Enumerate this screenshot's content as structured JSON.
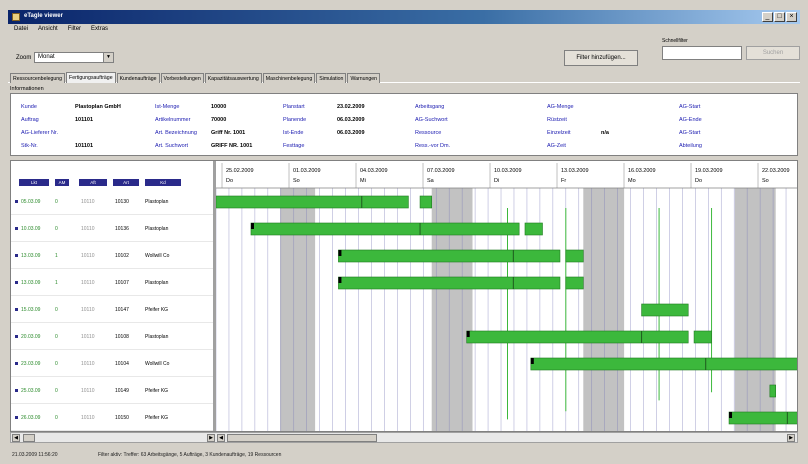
{
  "window": {
    "title": "eTagle viewer"
  },
  "menu": [
    "Datei",
    "Ansicht",
    "Filter",
    "Extras"
  ],
  "toolbar": {
    "zoom_label": "Zoom",
    "zoom_value": "Monat",
    "filter_button": "Filter hinzufügen...",
    "search_label": "Schnellfilter",
    "search_value": "",
    "search_button": "Suchen"
  },
  "tabs": [
    "Ressourcenbelegung",
    "Fertigungsaufträge",
    "Kundenaufträge",
    "Vorbestellungen",
    "Kapazitätsauswertung",
    "Maschinenbelegung",
    "Simulation",
    "Warnungen"
  ],
  "active_tab": 1,
  "info": {
    "label": "Informationen",
    "fields": [
      {
        "label": "Kunde",
        "value": "Plastoplan GmbH"
      },
      {
        "label": "Auftrag",
        "value": "101101"
      },
      {
        "label": "AG-Lieferer Nr.",
        "value": ""
      },
      {
        "label": "Stk-Nr.",
        "value": "101101"
      },
      {
        "label": "Ist-Menge",
        "value": "10000"
      },
      {
        "label": "Artikelnummer",
        "value": "70000"
      },
      {
        "label": "Art. Bezeichnung",
        "value": "Griff Nr. 1001"
      },
      {
        "label": "Art. Suchwort",
        "value": "GRIFF NR. 1001"
      },
      {
        "label": "Planstart",
        "value": "23.02.2009"
      },
      {
        "label": "Planende",
        "value": "06.03.2009"
      },
      {
        "label": "Ist-Ende",
        "value": "06.03.2009"
      },
      {
        "label": "Festtage",
        "value": ""
      },
      {
        "label": "Arbeitsgang",
        "value": ""
      },
      {
        "label": "AG-Suchwort",
        "value": ""
      },
      {
        "label": "Ressource",
        "value": ""
      },
      {
        "label": "Ress.-vor Dm.",
        "value": ""
      },
      {
        "label": "AG-Menge",
        "value": ""
      },
      {
        "label": "Rüstzeit",
        "value": ""
      },
      {
        "label": "Einzelzeit",
        "value": "n/a"
      },
      {
        "label": "AG-Zeit",
        "value": ""
      },
      {
        "label": "AG-Start",
        "value": ""
      },
      {
        "label": "AG-Ende",
        "value": ""
      },
      {
        "label": "AG-Start",
        "value": ""
      },
      {
        "label": "Abteilung",
        "value": ""
      }
    ]
  },
  "grid": {
    "columns": [
      "Lkt",
      "AM",
      "Aft",
      "Art",
      "Kd"
    ],
    "rows": [
      {
        "c1": "05.03.09",
        "c2": "0",
        "c3": "10110",
        "c4": "10130",
        "c5": "Plastoplan"
      },
      {
        "c1": "10.03.09",
        "c2": "0",
        "c3": "10110",
        "c4": "10136",
        "c5": "Plastoplan"
      },
      {
        "c1": "13.03.09",
        "c2": "1",
        "c3": "10110",
        "c4": "10102",
        "c5": "Wollwill Co"
      },
      {
        "c1": "13.03.09",
        "c2": "1",
        "c3": "10110",
        "c4": "10107",
        "c5": "Plastoplan"
      },
      {
        "c1": "15.03.09",
        "c2": "0",
        "c3": "10110",
        "c4": "10147",
        "c5": "Pfeifer KG"
      },
      {
        "c1": "20.03.09",
        "c2": "0",
        "c3": "10110",
        "c4": "10108",
        "c5": "Plastoplan"
      },
      {
        "c1": "23.03.09",
        "c2": "0",
        "c3": "10110",
        "c4": "10104",
        "c5": "Wollwill Co"
      },
      {
        "c1": "25.03.09",
        "c2": "0",
        "c3": "10110",
        "c4": "10149",
        "c5": "Pfeifer KG"
      },
      {
        "c1": "26.03.09",
        "c2": "0",
        "c3": "10110",
        "c4": "10150",
        "c5": "Pfeifer KG"
      }
    ]
  },
  "timeline": {
    "dates": [
      {
        "date": "25.02.2009",
        "day": "Do"
      },
      {
        "date": "01.03.2009",
        "day": "So"
      },
      {
        "date": "04.03.2009",
        "day": "Mi"
      },
      {
        "date": "07.03.2009",
        "day": "Sa"
      },
      {
        "date": "10.03.2009",
        "day": "Di"
      },
      {
        "date": "13.03.2009",
        "day": "Fr"
      },
      {
        "date": "16.03.2009",
        "day": "Mo"
      },
      {
        "date": "19.03.2009",
        "day": "Do"
      },
      {
        "date": "22.03.2009",
        "day": "So"
      }
    ],
    "bar_color": "#3cb83c",
    "weekend_color": "#a8a8a8",
    "bars": [
      {
        "row": 0,
        "start": 0,
        "end": 0.33,
        "split": 0.25,
        "tail": [
          0.35,
          0.37
        ]
      },
      {
        "row": 1,
        "start": 0.06,
        "end": 0.52,
        "split": 0.35,
        "tail": [
          0.53,
          0.56
        ]
      },
      {
        "row": 2,
        "start": 0.21,
        "end": 0.59,
        "split": 0.51,
        "tail": [
          0.6,
          0.63
        ]
      },
      {
        "row": 3,
        "start": 0.21,
        "end": 0.59,
        "split": 0.51,
        "tail": [
          0.6,
          0.63
        ]
      },
      {
        "row": 4,
        "start": 0.73,
        "end": 0.81,
        "split": null,
        "tail": null
      },
      {
        "row": 5,
        "start": 0.43,
        "end": 0.81,
        "split": 0.73,
        "tail": [
          0.82,
          0.85
        ]
      },
      {
        "row": 6,
        "start": 0.54,
        "end": 1.0,
        "split": 0.84,
        "tail": null
      },
      {
        "row": 7,
        "start": 0.95,
        "end": 0.96,
        "split": null,
        "tail": null
      },
      {
        "row": 8,
        "start": 0.88,
        "end": 1.0,
        "split": 0.98,
        "tail": null
      }
    ]
  },
  "status": {
    "time": "21.03.2009 11:56:20",
    "text": "Filter aktiv: Treffer: 63 Arbeitsgänge, 5 Aufträge, 3 Kundenaufträge, 19 Ressourcen"
  }
}
